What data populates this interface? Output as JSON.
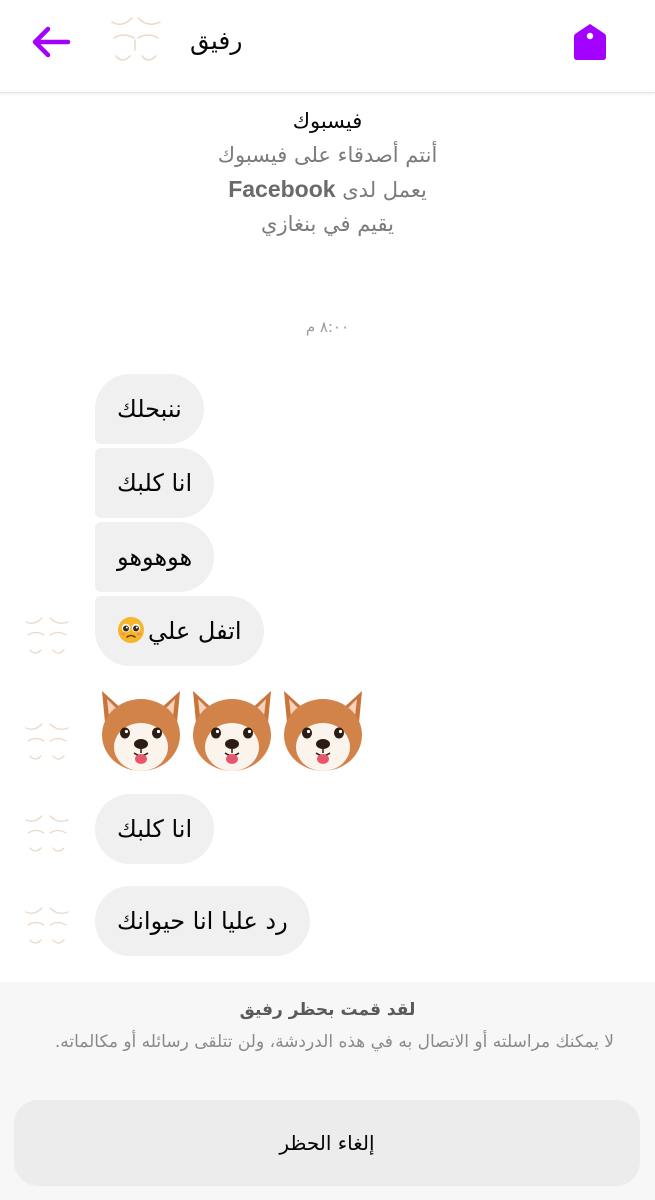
{
  "header": {
    "contact_name": "رفيق",
    "accent_color": "#a200ff",
    "back_icon": "arrow-left-icon",
    "tag_icon": "tag-icon"
  },
  "profile": {
    "title": "فيسبوك",
    "friends_text": "أنتم أصدقاء على فيسبوك",
    "works_prefix": "يعمل لدى",
    "works_company": "Facebook",
    "lives_text": "يقيم في بنغازي"
  },
  "conversation": {
    "timestamp": "٨:٠٠ م",
    "messages": [
      {
        "text": "ننبحلك"
      },
      {
        "text": "انا كلبك"
      },
      {
        "text": "هوهوهو"
      },
      {
        "text": "اتفل علي",
        "emoji": "pleading-face"
      },
      {
        "emoji_row": [
          "dog-face",
          "dog-face",
          "dog-face"
        ]
      },
      {
        "text": "انا كلبك"
      },
      {
        "text": "رد عليا انا حيوانك"
      }
    ]
  },
  "blocked_notice": {
    "title": "لقد قمت بحظر رفيق",
    "description": "لا يمكنك مراسلته أو الاتصال به في هذه الدردشة، ولن تتلقى رسائله أو مكالماته.",
    "unblock_label": "إلغاء الحظر"
  }
}
